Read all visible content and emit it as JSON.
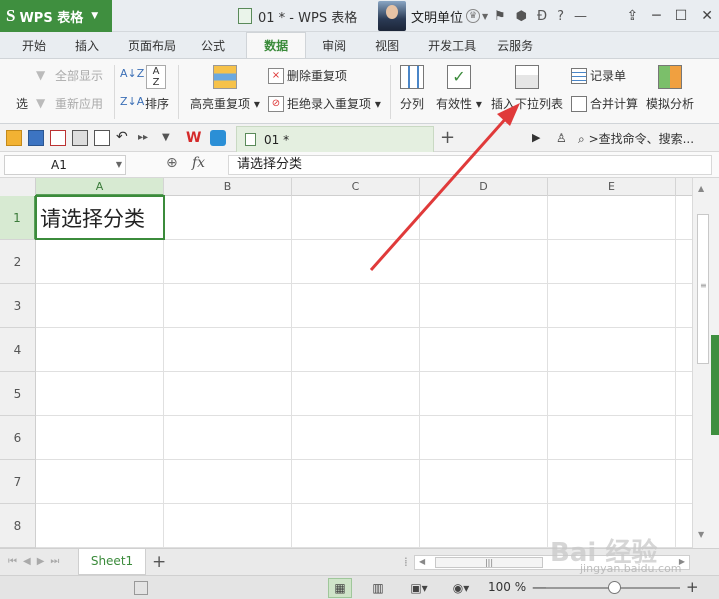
{
  "titlebar": {
    "app_name": "WPS 表格",
    "app_logo": "S",
    "doc_title": "01 * - WPS 表格",
    "user_name": "文明单位",
    "icons": [
      "flag-icon",
      "hexagon-icon",
      "d-icon",
      "help-icon",
      "minimize-icon"
    ],
    "help_label": "?"
  },
  "tabs": [
    "开始",
    "插入",
    "页面布局",
    "公式",
    "数据",
    "审阅",
    "视图",
    "开发工具",
    "云服务"
  ],
  "active_tab": "数据",
  "ribbon": {
    "filter_partial": "选",
    "show_all": "全部显示",
    "reapply": "重新应用",
    "sort": "排序",
    "highlight_dup": "高亮重复项",
    "remove_dup": "删除重复项",
    "reject_dup": "拒绝录入重复项",
    "split": "分列",
    "validity": "有效性",
    "insert_dropdown": "插入下拉列表",
    "record_sheet": "记录单",
    "merge_calc": "合并计算",
    "simulate": "模拟分析"
  },
  "qat": {
    "doc_tab": "01 *",
    "search_cmd": ">查找命令、搜索..."
  },
  "formula": {
    "cell_ref": "A1",
    "fx": "fx",
    "content": "请选择分类"
  },
  "grid": {
    "columns": [
      "A",
      "B",
      "C",
      "D",
      "E"
    ],
    "rows": [
      "1",
      "2",
      "3",
      "4",
      "5",
      "6",
      "7",
      "8"
    ],
    "active_cell_text": "请选择分类"
  },
  "sheetbar": {
    "sheet_name": "Sheet1",
    "add": "+"
  },
  "statusbar": {
    "zoom": "100 %",
    "minus": "—",
    "plus": "+"
  },
  "watermark": {
    "main": "Bai 经验",
    "sub": "jingyan.baidu.com"
  },
  "colors": {
    "accent_green": "#3f8f3f",
    "annotation_arrow": "#e03a3a"
  }
}
